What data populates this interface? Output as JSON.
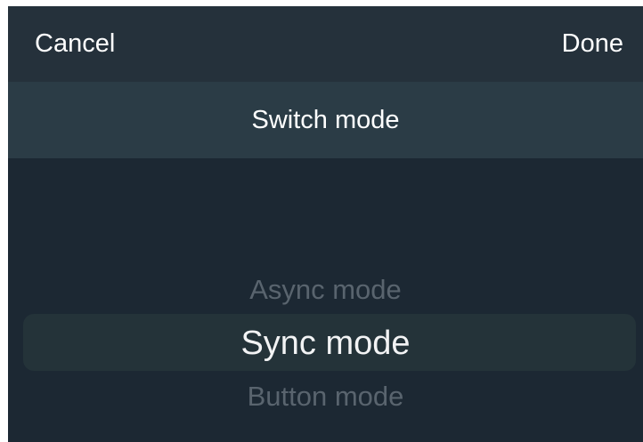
{
  "nav": {
    "cancel_label": "Cancel",
    "done_label": "Done"
  },
  "header": {
    "title": "Switch mode"
  },
  "picker": {
    "options": [
      "Async mode",
      "Sync mode",
      "Button mode"
    ],
    "selected": "Sync mode"
  },
  "colors": {
    "sheet_background": "#1c2833",
    "nav_background": "#25313b",
    "title_background": "#2b3c46",
    "selection_highlight": "#243339",
    "text_primary": "#ffffff",
    "text_dimmed": "#59646e"
  }
}
